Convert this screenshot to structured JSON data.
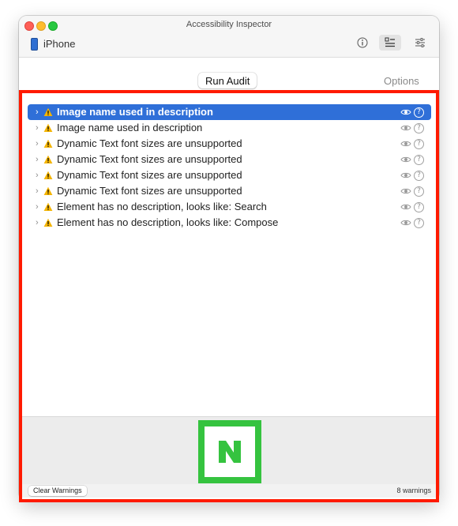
{
  "window": {
    "title": "Accessibility Inspector"
  },
  "toolbar": {
    "device": "iPhone",
    "icons": [
      "info-icon",
      "inspection-icon",
      "settings-icon"
    ]
  },
  "audit": {
    "run_label": "Run Audit",
    "options_label": "Options"
  },
  "warnings": [
    {
      "label": "Image name used in description",
      "selected": true
    },
    {
      "label": "Image name used in description",
      "selected": false
    },
    {
      "label": "Dynamic Text font sizes are unsupported",
      "selected": false
    },
    {
      "label": "Dynamic Text font sizes are unsupported",
      "selected": false
    },
    {
      "label": "Dynamic Text font sizes are unsupported",
      "selected": false
    },
    {
      "label": "Dynamic Text font sizes are unsupported",
      "selected": false
    },
    {
      "label": "Element has no description, looks like: Search",
      "selected": false
    },
    {
      "label": "Element has no description, looks like: Compose",
      "selected": false
    }
  ],
  "preview": {
    "thumbnail_letter": "N"
  },
  "status": {
    "clear_label": "Clear Warnings",
    "count_text": "8 warnings"
  },
  "colors": {
    "selection": "#2f6fd8",
    "warning": "#f4b400",
    "annotation_frame": "#ff1a00",
    "thumbnail": "#35c33f"
  }
}
